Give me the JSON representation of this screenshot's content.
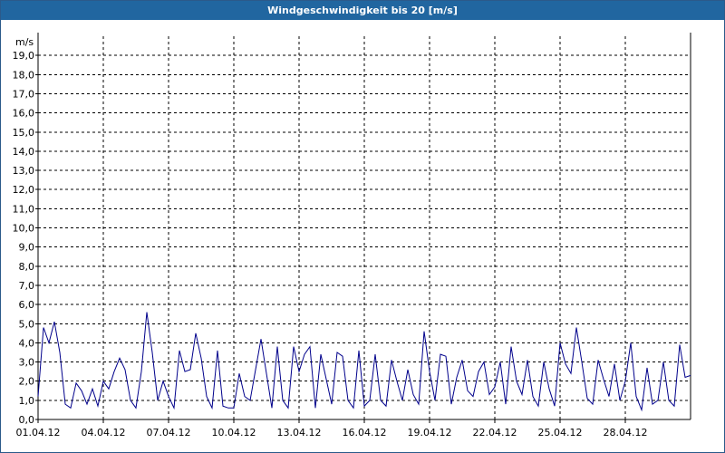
{
  "window": {
    "title": "Windgeschwindigkeit bis 20 [m/s]"
  },
  "colors": {
    "titlebar": "#2166a0",
    "series": "#00008b",
    "grid": "#000000",
    "background": "#ffffff"
  },
  "chart_data": {
    "type": "line",
    "title": "Windgeschwindigkeit bis 20 [m/s]",
    "ylabel": "m/s",
    "xlabel": "",
    "ylim": [
      0,
      20
    ],
    "xlim": [
      "2012-04-01",
      "2012-05-01"
    ],
    "grid": true,
    "y_ticks": [
      "0,0",
      "1,0",
      "2,0",
      "3,0",
      "4,0",
      "5,0",
      "6,0",
      "7,0",
      "8,0",
      "9,0",
      "10,0",
      "11,0",
      "12,0",
      "13,0",
      "14,0",
      "15,0",
      "16,0",
      "17,0",
      "18,0",
      "19,0"
    ],
    "x_ticks": [
      "01.04.12",
      "04.04.12",
      "07.04.12",
      "10.04.12",
      "13.04.12",
      "16.04.12",
      "19.04.12",
      "22.04.12",
      "25.04.12",
      "28.04.12"
    ],
    "series": [
      {
        "color": "#00008b",
        "x_days": [
          0,
          0.25,
          0.5,
          0.75,
          1,
          1.25,
          1.5,
          1.75,
          2,
          2.25,
          2.5,
          2.75,
          3,
          3.25,
          3.5,
          3.75,
          4,
          4.25,
          4.5,
          4.75,
          5,
          5.25,
          5.5,
          5.75,
          6,
          6.25,
          6.5,
          6.75,
          7,
          7.25,
          7.5,
          7.75,
          8,
          8.25,
          8.5,
          8.75,
          9,
          9.25,
          9.5,
          9.75,
          10,
          10.25,
          10.5,
          10.75,
          11,
          11.25,
          11.5,
          11.75,
          12,
          12.25,
          12.5,
          12.75,
          13,
          13.25,
          13.5,
          13.75,
          14,
          14.25,
          14.5,
          14.75,
          15,
          15.25,
          15.5,
          15.75,
          16,
          16.25,
          16.5,
          16.75,
          17,
          17.25,
          17.5,
          17.75,
          18,
          18.25,
          18.5,
          18.75,
          19,
          19.25,
          19.5,
          19.75,
          20,
          20.25,
          20.5,
          20.75,
          21,
          21.25,
          21.5,
          21.75,
          22,
          22.25,
          22.5,
          22.75,
          23,
          23.25,
          23.5,
          23.75,
          24,
          24.25,
          24.5,
          24.75,
          25,
          25.25,
          25.5,
          25.75,
          26,
          26.25,
          26.5,
          26.75,
          27,
          27.25,
          27.5,
          27.75,
          28,
          28.25,
          28.5,
          28.75,
          29,
          29.25,
          29.5,
          29.75,
          30
        ],
        "values": [
          1.2,
          4.8,
          4.0,
          5.1,
          3.5,
          0.8,
          0.6,
          1.9,
          1.5,
          0.8,
          1.6,
          0.7,
          2.0,
          1.6,
          2.5,
          3.2,
          2.6,
          1.0,
          0.6,
          2.5,
          5.6,
          3.5,
          1.0,
          2.0,
          1.2,
          0.6,
          3.6,
          2.5,
          2.6,
          4.5,
          3.2,
          1.2,
          0.6,
          3.6,
          0.7,
          0.6,
          0.6,
          2.4,
          1.2,
          1.0,
          2.6,
          4.2,
          2.4,
          0.6,
          3.8,
          1.0,
          0.6,
          3.8,
          2.5,
          3.4,
          3.8,
          0.6,
          3.4,
          2.1,
          0.8,
          3.5,
          3.3,
          1.0,
          0.6,
          3.6,
          0.7,
          1.0,
          3.4,
          1.0,
          0.7,
          3.1,
          2.0,
          1.0,
          2.6,
          1.3,
          0.8,
          4.6,
          2.5,
          1.0,
          3.4,
          3.3,
          0.8,
          2.2,
          3.1,
          1.5,
          1.2,
          2.5,
          3.0,
          1.3,
          1.7,
          3.0,
          0.8,
          3.8,
          2.0,
          1.3,
          3.1,
          1.2,
          0.7,
          3.0,
          1.6,
          0.7,
          4.0,
          2.9,
          2.4,
          4.8,
          3.0,
          1.1,
          0.8,
          3.1,
          2.1,
          1.2,
          2.9,
          1.0,
          2.0,
          4.0,
          1.2,
          0.5,
          2.7,
          0.8,
          1.0,
          3.0,
          1.0,
          0.7,
          3.9,
          2.2,
          2.3
        ]
      }
    ]
  }
}
